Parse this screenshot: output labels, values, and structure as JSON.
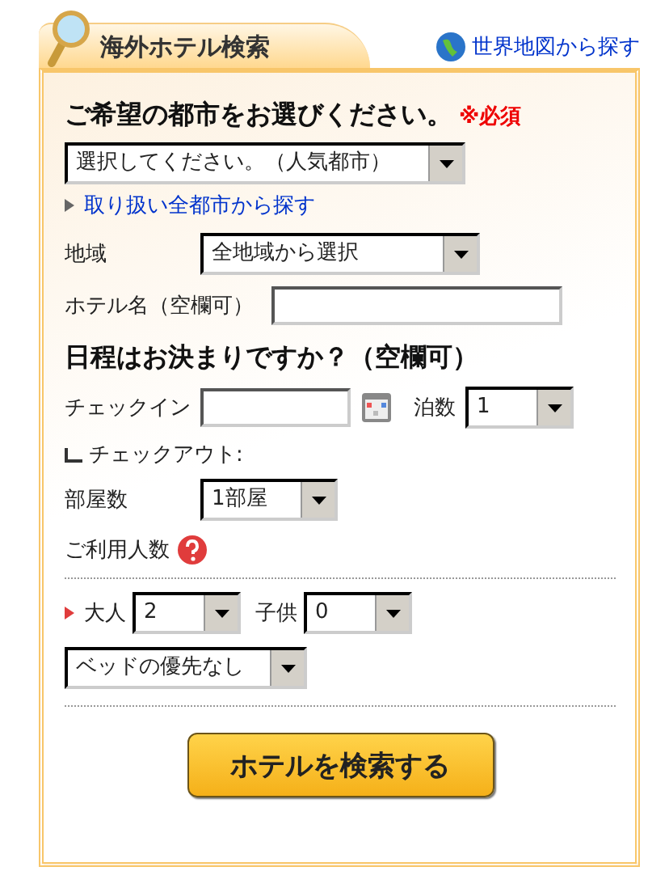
{
  "header": {
    "tab_title": "海外ホテル検索",
    "map_link": "世界地図から探す"
  },
  "city": {
    "heading": "ご希望の都市をお選びください。",
    "required": "※必須",
    "select": "選択してください。（人気都市）",
    "all_cities_link": "取り扱い全都市から探す"
  },
  "region": {
    "label": "地域",
    "select": "全地域から選択"
  },
  "hotel_name": {
    "label": "ホテル名（空欄可）"
  },
  "dates": {
    "heading": "日程はお決まりですか？（空欄可）",
    "checkin_label": "チェックイン",
    "nights_label": "泊数",
    "nights": "1",
    "checkout_label": "チェックアウト:"
  },
  "rooms": {
    "label": "部屋数",
    "select": "1部屋"
  },
  "guests": {
    "label": "ご利用人数",
    "adults_label": "大人",
    "adults": "2",
    "children_label": "子供",
    "children": "0",
    "bed": "ベッドの優先なし"
  },
  "search_button": "ホテルを検索する"
}
